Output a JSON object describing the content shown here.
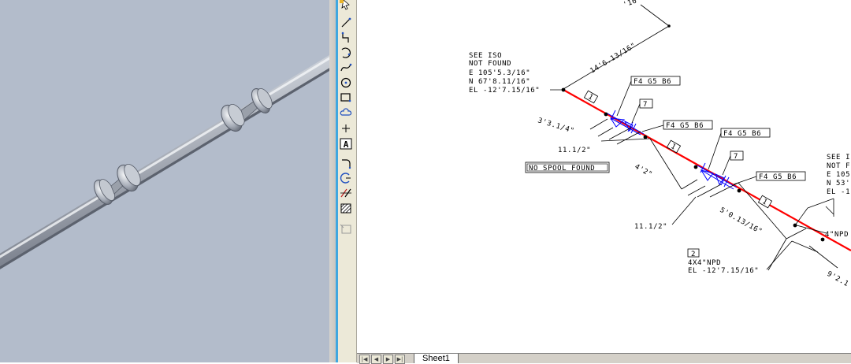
{
  "sheet_tab": "Sheet1",
  "tab_nav": [
    "first-sheet",
    "prev-sheet",
    "next-sheet",
    "last-sheet"
  ],
  "colors": {
    "pipe_run": "#ff0000",
    "fittings": "#0000ff",
    "viewport_bg": "#b3bccb"
  },
  "drawing": {
    "top_dim_partial": "'16\"",
    "dim_14_6": "14'6.13/16\"",
    "see_iso_left": [
      "SEE ISO",
      "NOT FOUND",
      "E 105'5.3/16\"",
      "N 67'8.11/16\"",
      "EL -12'7.15/16\""
    ],
    "see_iso_right": [
      "SEE I",
      "NOT F",
      "E 105",
      "N 53'",
      "EL -1"
    ],
    "tag_f4_1": "F4 G5 B6",
    "tag_f4_2": "F4 G5 B6",
    "tag_f4_3": "F4 G5 B6",
    "tag_f4_4": "F4 G5 B6",
    "num_7_a": "7",
    "num_7_b": "7",
    "num_1_a": "1",
    "num_1_b": "1",
    "num_1_c": "1",
    "dim_3_3": "3'3.1/4\"",
    "dim_11_a": "11.1/2\"",
    "dim_4_2": "4'2\"",
    "dim_11_b": "11.1/2\"",
    "dim_5_0": "5'0.13/16\"",
    "dim_9_2": "9'2.1",
    "no_spool": "NO SPOOL FOUND",
    "npd_partial": "4\"NPD",
    "item_2": "2",
    "reducer": [
      "4X4\"NPD",
      "EL -12'7.15/16\""
    ]
  }
}
